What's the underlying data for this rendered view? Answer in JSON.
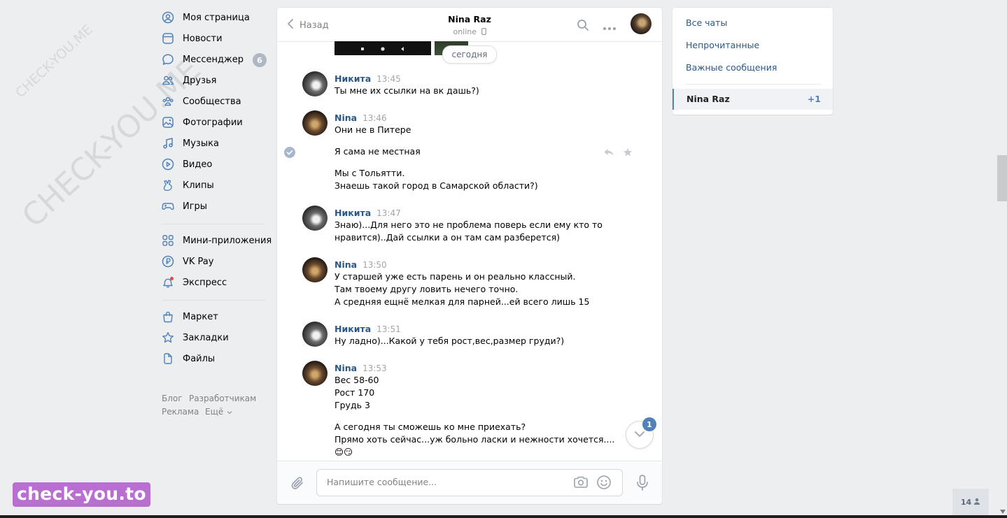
{
  "watermark": {
    "small": "CHECK-YOU.ME",
    "large": "CHECK-YOU.ME",
    "brand": "check-you.to"
  },
  "nav": {
    "items": [
      {
        "label": "Моя страница",
        "icon": "user-circle-icon"
      },
      {
        "label": "Новости",
        "icon": "news-icon"
      },
      {
        "label": "Мессенджер",
        "icon": "chat-bubble-icon",
        "badge": "6"
      },
      {
        "label": "Друзья",
        "icon": "friends-icon"
      },
      {
        "label": "Сообщества",
        "icon": "groups-icon"
      },
      {
        "label": "Фотографии",
        "icon": "photo-icon"
      },
      {
        "label": "Музыка",
        "icon": "music-note-icon"
      },
      {
        "label": "Видео",
        "icon": "video-play-icon"
      },
      {
        "label": "Клипы",
        "icon": "clips-icon"
      },
      {
        "label": "Игры",
        "icon": "gamepad-icon"
      },
      {
        "label": "Мини-приложения",
        "icon": "mini-apps-icon"
      },
      {
        "label": "VK Pay",
        "icon": "ruble-icon"
      },
      {
        "label": "Экспресс",
        "icon": "express-icon"
      },
      {
        "label": "Маркет",
        "icon": "bag-icon"
      },
      {
        "label": "Закладки",
        "icon": "star-icon"
      },
      {
        "label": "Файлы",
        "icon": "file-icon"
      }
    ],
    "footer": {
      "blog": "Блог",
      "dev": "Разработчикам",
      "ads": "Реклама",
      "more": "Ещё"
    }
  },
  "chat": {
    "back_label": "Назад",
    "peer_name": "Nina Raz",
    "peer_status": "online",
    "date_divider": "сегодня",
    "messages": [
      {
        "author": "Никита",
        "time": "13:45",
        "lines": [
          "Ты мне их ссылки на вк дашь?)"
        ]
      },
      {
        "author": "Nina",
        "time": "13:46",
        "lines": [
          "Они не в Питере"
        ]
      },
      {
        "lines": [
          "Я сама не местная"
        ]
      },
      {
        "lines": [
          "Мы с Тольятти.",
          "Знаешь такой город в Самарской области?)"
        ]
      },
      {
        "author": "Никита",
        "time": "13:47",
        "lines": [
          "Знаю)...Для него это не проблема поверь если ему кто то",
          "нравится)..Дай ссылки а он там сам разберется)"
        ]
      },
      {
        "author": "Nina",
        "time": "13:50",
        "lines": [
          "У старшей уже есть парень и он реально классный.",
          "Там твоему другу ловить нечего точно.",
          "А средняя ещнё мелкая для парней...ей всего лишь 15"
        ]
      },
      {
        "author": "Никита",
        "time": "13:51",
        "lines": [
          "Ну ладно)...Какой у тебя рост,вес,размер груди?)"
        ]
      },
      {
        "author": "Nina",
        "time": "13:53",
        "lines": [
          "Вес 58-60",
          "Рост 170",
          "Грудь 3"
        ]
      },
      {
        "lines": [
          "А сегодня ты сможешь ко мне приехать?",
          "Прямо хоть сейчас...уж больно ласки и нежности хочется....",
          "😊😏"
        ]
      }
    ],
    "unread_badge": "1",
    "composer_placeholder": "Напишите сообщение..."
  },
  "right_panel": {
    "all_chats": "Все чаты",
    "unread": "Непрочитанные",
    "important": "Важные сообщения",
    "active_chat": "Nina Raz",
    "active_count": "+1"
  },
  "online_counter": "14",
  "colors": {
    "link": "#2a5885",
    "accent": "#5181b8",
    "background": "#edeef0"
  }
}
